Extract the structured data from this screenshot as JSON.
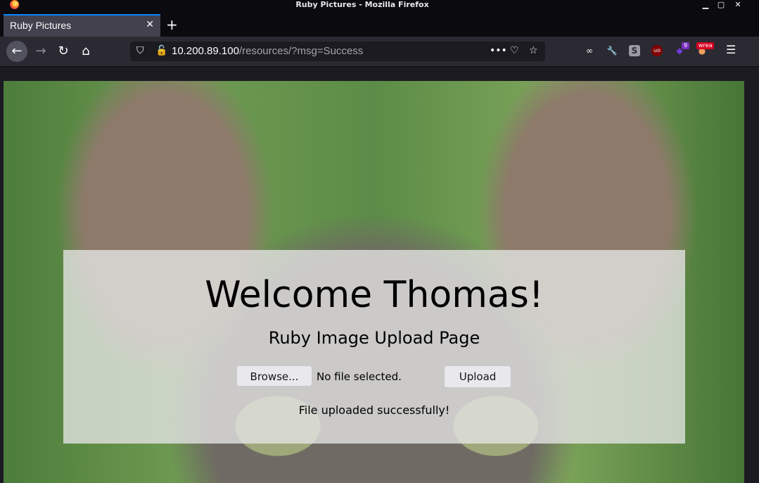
{
  "window": {
    "title": "Ruby Pictures - Mozilla Firefox",
    "minimize": "▁",
    "maximize": "▢",
    "close": "✕"
  },
  "tab": {
    "label": "Ruby Pictures",
    "close": "✕",
    "new_tab": "+"
  },
  "nav": {
    "back": "←",
    "forward": "→",
    "reload": "↻",
    "home": "⌂"
  },
  "url": {
    "host": "10.200.89.100",
    "path": "/resources/?msg=Success"
  },
  "extensions": {
    "ublock_label": "uo",
    "badge_count": "9",
    "wrea_label": "wrea"
  },
  "page": {
    "heading": "Welcome Thomas!",
    "subheading": "Ruby Image Upload Page",
    "browse_label": "Browse...",
    "file_status": "No file selected.",
    "upload_label": "Upload",
    "message": "File uploaded successfully!"
  }
}
